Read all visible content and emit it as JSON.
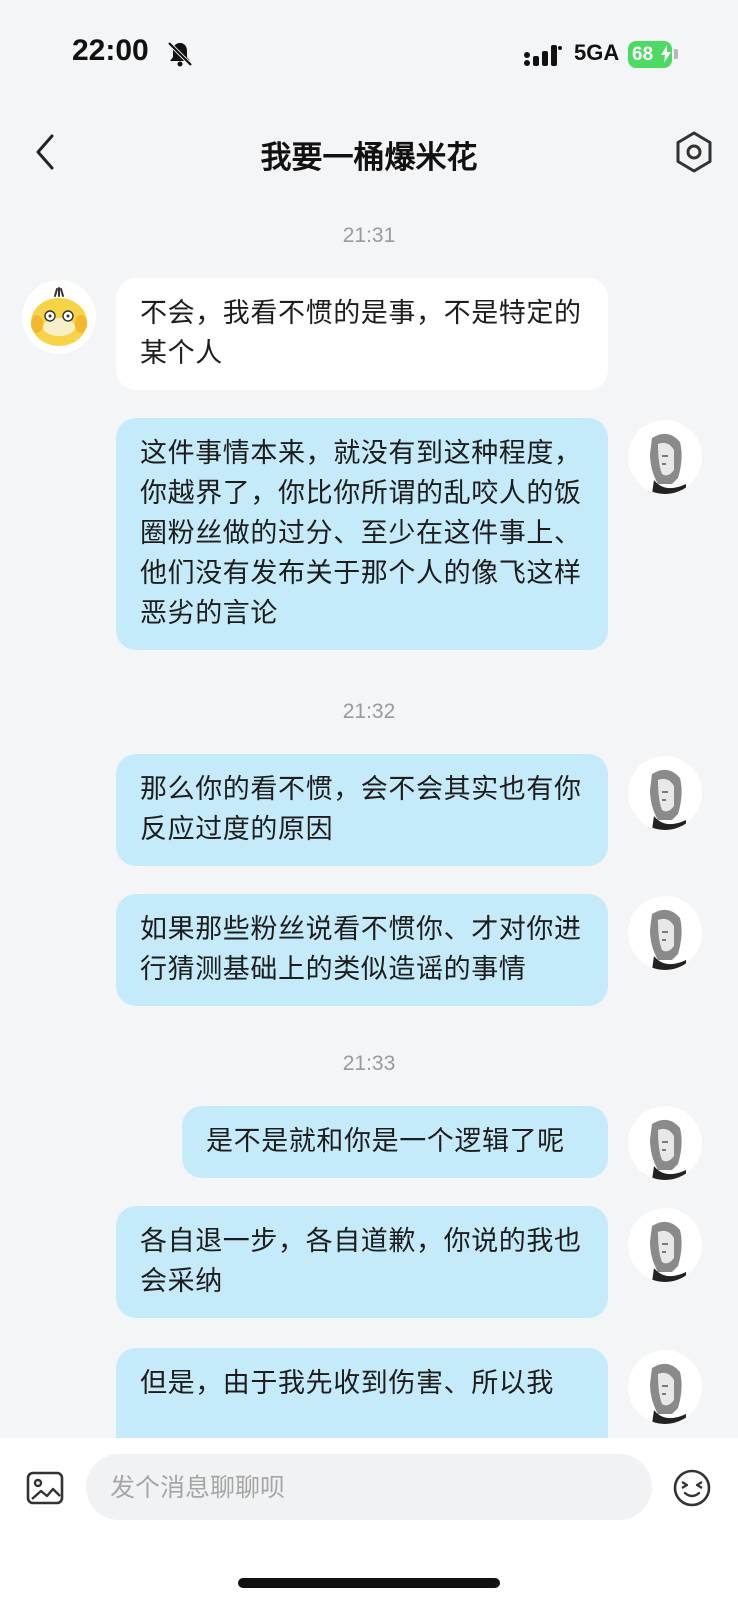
{
  "status_bar": {
    "time": "22:00",
    "network": "5GA",
    "battery": "68",
    "bell_icon": "bell-muted-icon",
    "signal_icon": "signal-bars-icon"
  },
  "header": {
    "title": "我要一桶爆米花",
    "back_icon": "chevron-left-icon",
    "settings_icon": "hexagon-settings-icon"
  },
  "timestamps": [
    "21:31",
    "21:32",
    "21:33"
  ],
  "messages": [
    {
      "side": "received",
      "text": "不会，我看不惯的是事，不是特定的某个人"
    },
    {
      "side": "sent",
      "text": "这件事情本来，就没有到这种程度，你越界了，你比你所谓的乱咬人的饭圈粉丝做的过分、至少在这件事上、他们没有发布关于那个人的像飞这样恶劣的言论"
    },
    {
      "side": "sent",
      "text": "那么你的看不惯，会不会其实也有你反应过度的原因"
    },
    {
      "side": "sent",
      "text": "如果那些粉丝说看不惯你、才对你进行猜测基础上的类似造谣的事情"
    },
    {
      "side": "sent",
      "text": "是不是就和你是一个逻辑了呢"
    },
    {
      "side": "sent",
      "text": "各自退一步，各自道歉，你说的我也会采纳"
    },
    {
      "side": "sent",
      "text": "但是，由于我先收到伤害、所以我"
    }
  ],
  "input": {
    "placeholder": "发个消息聊聊呗",
    "value": ""
  },
  "colors": {
    "background": "#f4f5f7",
    "sent_bubble": "#c5eaf9",
    "received_bubble": "#ffffff",
    "battery": "#4cd964"
  }
}
